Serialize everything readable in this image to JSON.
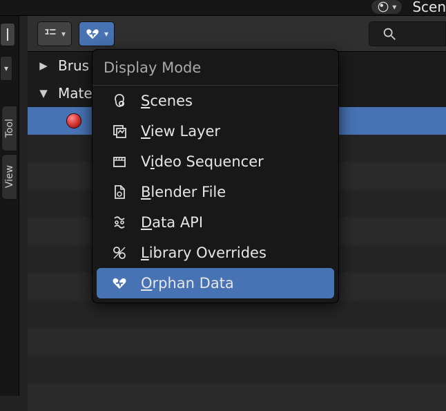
{
  "topbar": {
    "scene_label": "Scen"
  },
  "left_strip": {
    "tool_tab": "Tool",
    "view_tab": "View"
  },
  "header": {
    "search_placeholder": ""
  },
  "tree": {
    "items": [
      {
        "label": "Brus",
        "expanded": false
      },
      {
        "label": "Mate",
        "expanded": true
      }
    ],
    "selected_child_index": 0
  },
  "popup": {
    "title": "Display Mode",
    "items": [
      {
        "label": "Scenes",
        "hotkey_index": 0
      },
      {
        "label": "View Layer",
        "hotkey_index": 0
      },
      {
        "label": "Video Sequencer",
        "hotkey_index": 1
      },
      {
        "label": "Blender File",
        "hotkey_index": 0
      },
      {
        "label": "Data API",
        "hotkey_index": 0
      },
      {
        "label": "Library Overrides",
        "hotkey_index": 0
      },
      {
        "label": "Orphan Data",
        "hotkey_index": 0
      }
    ],
    "selected_index": 6
  },
  "colors": {
    "accent": "#4772b3"
  }
}
